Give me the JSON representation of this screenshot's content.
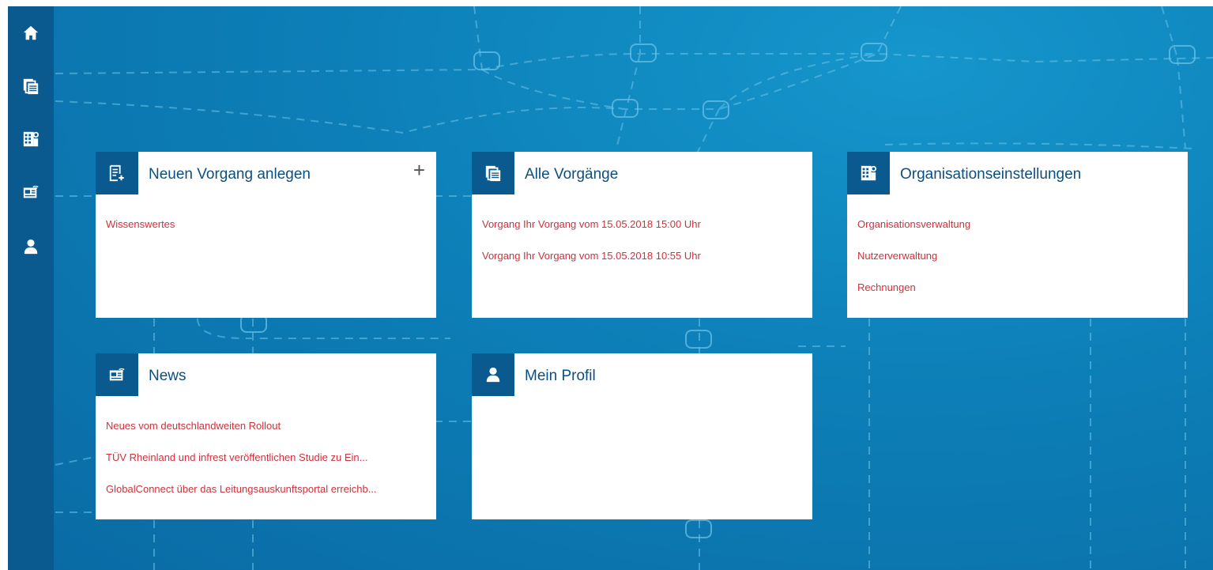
{
  "sidebar": {
    "items": [
      {
        "icon": "home-icon"
      },
      {
        "icon": "documents-icon"
      },
      {
        "icon": "organization-icon"
      },
      {
        "icon": "news-icon"
      },
      {
        "icon": "user-icon"
      }
    ]
  },
  "cards": {
    "new_case": {
      "icon": "add-document-icon",
      "title": "Neuen Vorgang anlegen",
      "plus": "+",
      "links": [
        "Wissenswertes"
      ]
    },
    "all_cases": {
      "icon": "documents-icon",
      "title": "Alle Vorgänge",
      "links": [
        "Vorgang Ihr Vorgang vom 15.05.2018 15:00 Uhr",
        "Vorgang Ihr Vorgang vom 15.05.2018 10:55 Uhr"
      ]
    },
    "org_settings": {
      "icon": "organization-icon",
      "title": "Organisationseinstellungen",
      "links": [
        "Organisationsverwaltung",
        "Nutzerverwaltung",
        "Rechnungen"
      ]
    },
    "news": {
      "icon": "news-icon",
      "title": "News",
      "links": [
        "Neues vom deutschlandweiten Rollout",
        "TÜV Rheinland und infrest veröffentlichen Studie zu Ein...",
        "GlobalConnect über das Leitungsauskunftsportal erreichb..."
      ]
    },
    "profile": {
      "icon": "user-icon",
      "title": "Mein Profil",
      "links": []
    }
  },
  "colors": {
    "sidebar": "#0b5a8f",
    "background": "#0d7fb8",
    "title": "#0b4f80",
    "link": "#d1303a"
  }
}
